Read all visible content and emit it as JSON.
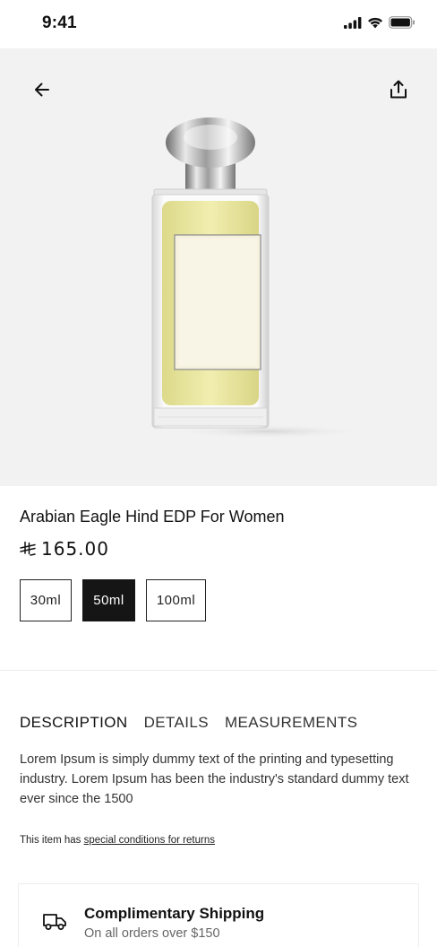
{
  "status_bar": {
    "time": "9:41"
  },
  "header": {
    "back_icon": "arrow-left-icon",
    "share_icon": "share-icon"
  },
  "product": {
    "title": "Arabian Eagle Hind EDP For Women",
    "currency_symbol": "⃁",
    "price": "165.00",
    "sizes": [
      {
        "label": "30ml",
        "selected": false
      },
      {
        "label": "50ml",
        "selected": true
      },
      {
        "label": "100ml",
        "selected": false
      }
    ]
  },
  "tabs": [
    {
      "label": "DESCRIPTION",
      "active": true
    },
    {
      "label": "DETAILS",
      "active": false
    },
    {
      "label": "MEASUREMENTS",
      "active": false
    }
  ],
  "description": "Lorem Ipsum is simply dummy text of the printing and typesetting industry. Lorem Ipsum has been the industry's standard dummy text ever since the 1500",
  "returns": {
    "prefix": "This item has",
    "link": "special conditions for returns"
  },
  "shipping": {
    "icon": "truck-icon",
    "title": "Complimentary Shipping",
    "subtitle": "On all orders over $150"
  },
  "colors": {
    "hero_background": "#f2f2f2",
    "selected_size": "#151515",
    "perfume_liquid": "#efeba8"
  }
}
